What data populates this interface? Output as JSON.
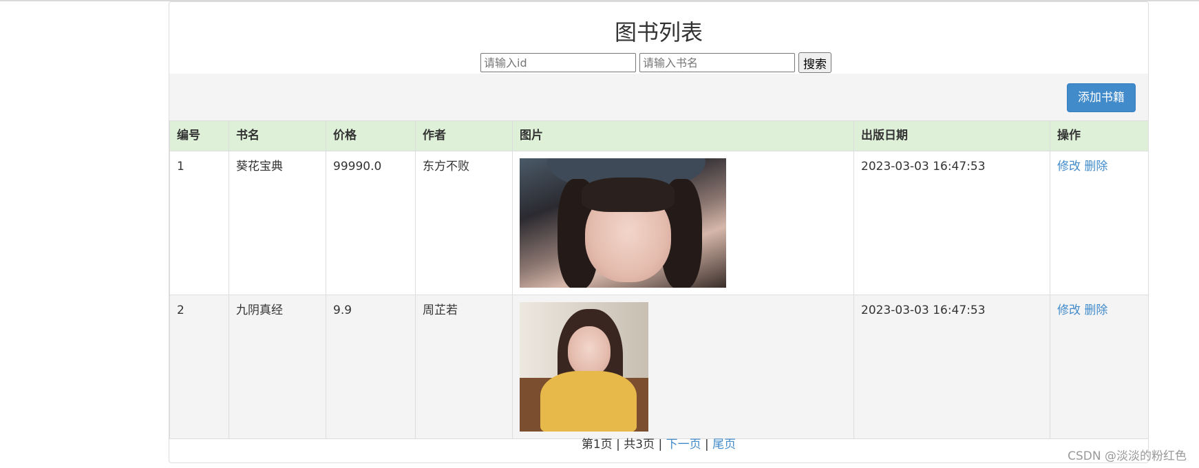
{
  "page": {
    "title": "图书列表"
  },
  "search": {
    "id_placeholder": "请输入id",
    "name_placeholder": "请输入书名",
    "button_label": "搜索"
  },
  "toolbar": {
    "add_label": "添加书籍"
  },
  "table": {
    "headers": [
      "编号",
      "书名",
      "价格",
      "作者",
      "图片",
      "出版日期",
      "操作"
    ],
    "rows": [
      {
        "id": "1",
        "name": "葵花宝典",
        "price": "99990.0",
        "author": "东方不败",
        "image": "photo-of-girl-in-helmet",
        "date": "2023-03-03 16:47:53",
        "edit_label": "修改",
        "delete_label": "删除"
      },
      {
        "id": "2",
        "name": "九阴真经",
        "price": "9.9",
        "author": "周芷若",
        "image": "photo-of-girl-in-yellow-hoodie",
        "date": "2023-03-03 16:47:53",
        "edit_label": "修改",
        "delete_label": "删除"
      }
    ]
  },
  "pager": {
    "current": "第1页",
    "sep1": " | ",
    "total": "共3页",
    "sep2": " | ",
    "next_label": "下一页",
    "sep3": " | ",
    "last_label": "尾页"
  },
  "watermark": "CSDN @淡淡的粉红色",
  "colors": {
    "accent": "#428bca",
    "header_bg": "#dff0d8",
    "toolbar_bg": "#f4f4f4"
  }
}
